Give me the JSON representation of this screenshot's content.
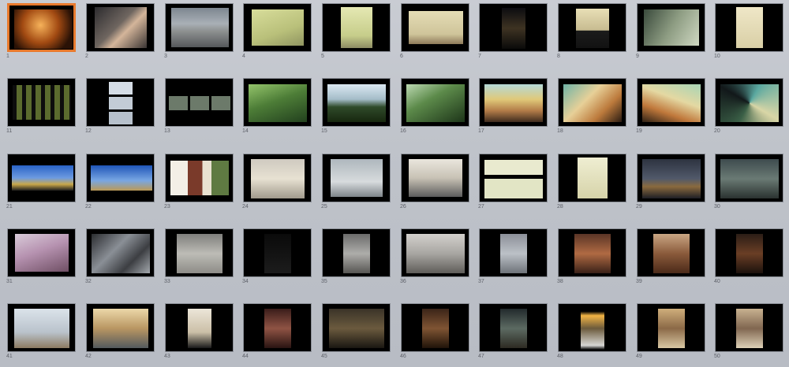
{
  "selected_slide": 1,
  "slides": [
    {
      "number": "1",
      "art": "photo-warm-performance"
    },
    {
      "number": "2",
      "art": "photo-nude-figures"
    },
    {
      "number": "3",
      "art": "photo-white-car"
    },
    {
      "number": "4",
      "art": "photo-device-on-table"
    },
    {
      "number": "5",
      "art": "photo-pale-green-room"
    },
    {
      "number": "6",
      "art": "photo-gallery-table"
    },
    {
      "number": "7",
      "art": "photo-candle"
    },
    {
      "number": "8",
      "art": "photo-dark-machine"
    },
    {
      "number": "9",
      "art": "photo-projector-green"
    },
    {
      "number": "10",
      "art": "photo-hanging-object"
    },
    {
      "number": "11",
      "art": "photo-contact-grid"
    },
    {
      "number": "12",
      "art": "photo-three-vertical"
    },
    {
      "number": "13",
      "art": "photo-three-horizontal"
    },
    {
      "number": "14",
      "art": "photo-forest-figure"
    },
    {
      "number": "15",
      "art": "photo-trees-sky"
    },
    {
      "number": "16",
      "art": "photo-garden-figures"
    },
    {
      "number": "17",
      "art": "photo-blur-horizon"
    },
    {
      "number": "18",
      "art": "photo-blur-feet"
    },
    {
      "number": "19",
      "art": "photo-blur-feet-2"
    },
    {
      "number": "20",
      "art": "photo-blur-swirl"
    },
    {
      "number": "21",
      "art": "photo-double-sky"
    },
    {
      "number": "22",
      "art": "photo-double-sky-2"
    },
    {
      "number": "23",
      "art": "photo-collage-red"
    },
    {
      "number": "24",
      "art": "photo-white-room"
    },
    {
      "number": "25",
      "art": "photo-legs-floor"
    },
    {
      "number": "26",
      "art": "photo-studio-desk"
    },
    {
      "number": "27",
      "art": "photo-four-objects"
    },
    {
      "number": "28",
      "art": "photo-object-pale"
    },
    {
      "number": "29",
      "art": "photo-courtyard"
    },
    {
      "number": "30",
      "art": "photo-courtyard-2"
    },
    {
      "number": "31",
      "art": "photo-pink-room"
    },
    {
      "number": "32",
      "art": "photo-steel-frame"
    },
    {
      "number": "33",
      "art": "photo-grey-wall"
    },
    {
      "number": "34",
      "art": "photo-dark-strand"
    },
    {
      "number": "35",
      "art": "photo-hanging-sphere"
    },
    {
      "number": "36",
      "art": "photo-silver-form"
    },
    {
      "number": "37",
      "art": "photo-curtain-light"
    },
    {
      "number": "38",
      "art": "photo-copper-room"
    },
    {
      "number": "39",
      "art": "photo-wood-structure"
    },
    {
      "number": "40",
      "art": "photo-dark-copper"
    },
    {
      "number": "41",
      "art": "photo-wood-frame"
    },
    {
      "number": "42",
      "art": "photo-wood-stairs"
    },
    {
      "number": "43",
      "art": "photo-lamp-stand"
    },
    {
      "number": "44",
      "art": "photo-dark-vessel"
    },
    {
      "number": "45",
      "art": "photo-dark-hall"
    },
    {
      "number": "46",
      "art": "photo-dim-room"
    },
    {
      "number": "47",
      "art": "photo-stacked-stones"
    },
    {
      "number": "48",
      "art": "photo-candle-glass"
    },
    {
      "number": "49",
      "art": "photo-metal-bowl"
    },
    {
      "number": "50",
      "art": "photo-metal-bowl-2"
    }
  ],
  "colors": {
    "selection": "#e97a2d",
    "background": "#c4c7ce",
    "number_text": "#5d6068"
  }
}
